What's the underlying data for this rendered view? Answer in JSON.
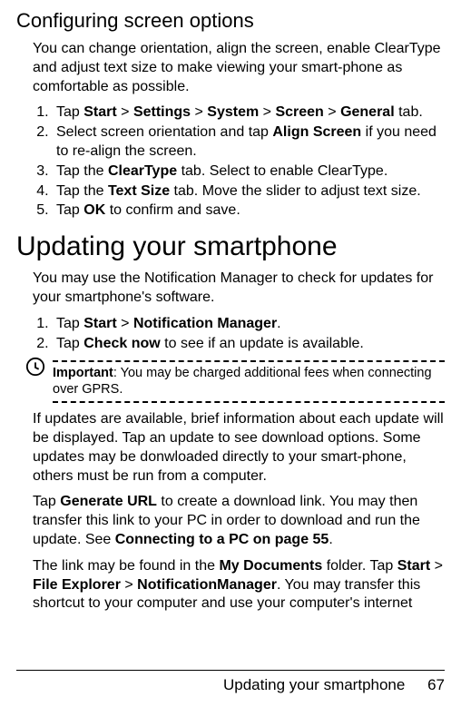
{
  "section1": {
    "heading": "Configuring screen options",
    "intro": "You can change orientation, align the screen, enable ClearType and adjust text size to make viewing your smart-phone as comfortable as possible.",
    "steps": [
      {
        "prefix": "Tap ",
        "parts": [
          {
            "t": "Start",
            "b": true
          },
          {
            "t": " > ",
            "b": false
          },
          {
            "t": "Settings",
            "b": true
          },
          {
            "t": " > ",
            "b": false
          },
          {
            "t": "System",
            "b": true
          },
          {
            "t": " > ",
            "b": false
          },
          {
            "t": "Screen",
            "b": true
          },
          {
            "t": " > ",
            "b": false
          },
          {
            "t": "General",
            "b": true
          },
          {
            "t": " tab.",
            "b": false
          }
        ]
      },
      {
        "prefix": "",
        "parts": [
          {
            "t": "Select screen orientation and tap ",
            "b": false
          },
          {
            "t": "Align Screen",
            "b": true
          },
          {
            "t": " if you need to re-align the screen.",
            "b": false
          }
        ]
      },
      {
        "prefix": "",
        "parts": [
          {
            "t": "Tap the ",
            "b": false
          },
          {
            "t": "ClearType",
            "b": true
          },
          {
            "t": " tab. Select to enable ClearType.",
            "b": false
          }
        ]
      },
      {
        "prefix": "",
        "parts": [
          {
            "t": "Tap the ",
            "b": false
          },
          {
            "t": "Text Size",
            "b": true
          },
          {
            "t": " tab. Move the slider to adjust text size.",
            "b": false
          }
        ]
      },
      {
        "prefix": "",
        "parts": [
          {
            "t": "Tap ",
            "b": false
          },
          {
            "t": "OK",
            "b": true
          },
          {
            "t": " to confirm and save.",
            "b": false
          }
        ]
      }
    ]
  },
  "section2": {
    "heading": "Updating your smartphone",
    "intro": "You may use the Notification Manager to check for updates for your smartphone's software.",
    "steps": [
      {
        "prefix": "",
        "parts": [
          {
            "t": "Tap ",
            "b": false
          },
          {
            "t": "Start",
            "b": true
          },
          {
            "t": " > ",
            "b": false
          },
          {
            "t": "Notification Manager",
            "b": true
          },
          {
            "t": ".",
            "b": false
          }
        ]
      },
      {
        "prefix": "",
        "parts": [
          {
            "t": "Tap ",
            "b": false
          },
          {
            "t": "Check now",
            "b": true
          },
          {
            "t": " to see if an update is available.",
            "b": false
          }
        ]
      }
    ],
    "important_label": "Important",
    "important_text": ": You may be charged additional fees when connecting over GPRS.",
    "para1": "If updates are available, brief information about each update will be displayed. Tap an update to see download options. Some updates may be donwloaded directly to your smart-phone, others must be run from a computer.",
    "para2_parts": [
      {
        "t": "Tap ",
        "b": false
      },
      {
        "t": "Generate URL",
        "b": true
      },
      {
        "t": " to create a download link. You may then transfer this link to your PC in order to download and run the update. See ",
        "b": false
      },
      {
        "t": "Connecting to a PC on page 55",
        "b": true
      },
      {
        "t": ".",
        "b": false
      }
    ],
    "para3_parts": [
      {
        "t": "The link may be found in the ",
        "b": false
      },
      {
        "t": "My Documents",
        "b": true
      },
      {
        "t": " folder. Tap ",
        "b": false
      },
      {
        "t": "Start",
        "b": true
      },
      {
        "t": " > ",
        "b": false
      },
      {
        "t": "File Explorer",
        "b": true
      },
      {
        "t": " > ",
        "b": false
      },
      {
        "t": "NotificationManager",
        "b": true
      },
      {
        "t": ". You may transfer this shortcut to your computer and use your computer's internet",
        "b": false
      }
    ]
  },
  "footer": {
    "title": "Updating your smartphone",
    "page": "67"
  }
}
